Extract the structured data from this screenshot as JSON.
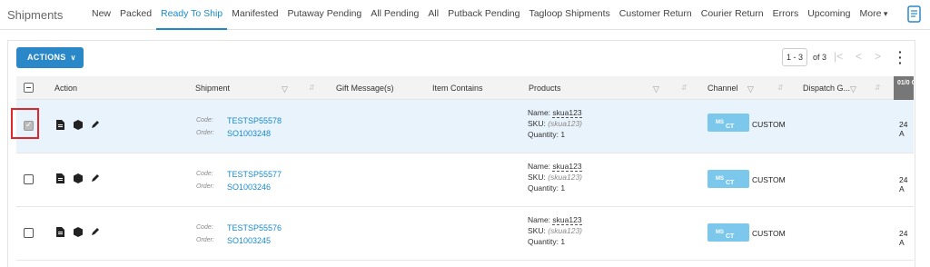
{
  "header": {
    "title": "Shipments",
    "tabs": [
      {
        "label": "New",
        "active": false
      },
      {
        "label": "Packed",
        "active": false
      },
      {
        "label": "Ready To Ship",
        "active": true
      },
      {
        "label": "Manifested",
        "active": false
      },
      {
        "label": "Putaway Pending",
        "active": false
      },
      {
        "label": "All Pending",
        "active": false
      },
      {
        "label": "All",
        "active": false
      },
      {
        "label": "Putback Pending",
        "active": false
      },
      {
        "label": "Tagloop Shipments",
        "active": false
      },
      {
        "label": "Customer Return",
        "active": false
      },
      {
        "label": "Courier Return",
        "active": false
      },
      {
        "label": "Errors",
        "active": false
      },
      {
        "label": "Upcoming",
        "active": false
      },
      {
        "label": "More",
        "active": false
      }
    ],
    "doc_icon": "document-list-icon"
  },
  "toolbar": {
    "actions_label": "ACTIONS",
    "pager_range": "1 - 3",
    "pager_total": "of 3"
  },
  "table": {
    "columns": [
      "Action",
      "Shipment",
      "Gift Message(s)",
      "Item Contains",
      "Products",
      "Channel",
      "Dispatch G...",
      "01/0 Crea"
    ],
    "rows": [
      {
        "selected": true,
        "code_label": "Code:",
        "code": "TESTSP55578",
        "order_label": "Order:",
        "order": "SO1003248",
        "product_name_label": "Name:",
        "product_name": "skua123",
        "sku_label": "SKU:",
        "sku": "(skua123)",
        "quantity": "Quantity: 1",
        "channel_badge_top": "MS",
        "channel_badge": "CT",
        "channel": "CUSTOM",
        "date": "24 A"
      },
      {
        "selected": false,
        "code_label": "Code:",
        "code": "TESTSP55577",
        "order_label": "Order:",
        "order": "SO1003246",
        "product_name_label": "Name:",
        "product_name": "skua123",
        "sku_label": "SKU:",
        "sku": "(skua123)",
        "quantity": "Quantity: 1",
        "channel_badge_top": "MS",
        "channel_badge": "CT",
        "channel": "CUSTOM",
        "date": "24 A"
      },
      {
        "selected": false,
        "code_label": "Code:",
        "code": "TESTSP55576",
        "order_label": "Order:",
        "order": "SO1003245",
        "product_name_label": "Name:",
        "product_name": "skua123",
        "sku_label": "SKU:",
        "sku": "(skua123)",
        "quantity": "Quantity: 1",
        "channel_badge_top": "MS",
        "channel_badge": "CT",
        "channel": "CUSTOM",
        "date": "24 A"
      }
    ]
  },
  "colors": {
    "accent": "#1a8acb",
    "button": "#2a87c8",
    "selected_row": "#e9f3fb",
    "badge": "#7cc8ec",
    "highlight_box": "#e0262a"
  }
}
